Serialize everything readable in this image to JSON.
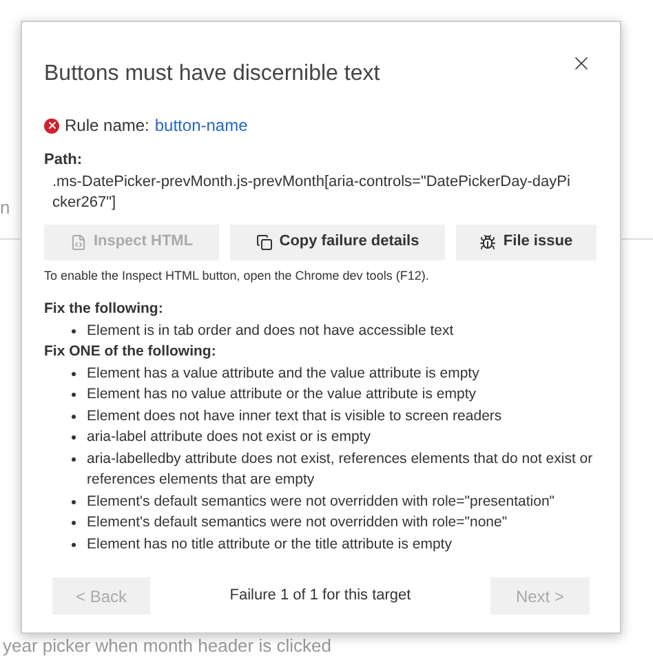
{
  "background": {
    "texts": [
      "n",
      "year picker when month header is clicked"
    ]
  },
  "dialog": {
    "title": "Buttons must have discernible text",
    "rule": {
      "label": "Rule name:",
      "value": "button-name"
    },
    "path": {
      "label": "Path:",
      "value": ".ms-DatePicker-prevMonth.js-prevMonth[aria-controls=\"DatePickerDay-dayPicker267\"]"
    },
    "actions": [
      {
        "label": "Inspect HTML",
        "disabled": true
      },
      {
        "label": "Copy failure details",
        "disabled": false
      },
      {
        "label": "File issue",
        "disabled": false
      }
    ],
    "hint": "To enable the Inspect HTML button, open the Chrome dev tools (F12).",
    "sections": [
      {
        "heading": "Fix the following:",
        "items": [
          "Element is in tab order and does not have accessible text"
        ]
      },
      {
        "heading": "Fix ONE of the following:",
        "items": [
          "Element has a value attribute and the value attribute is empty",
          "Element has no value attribute or the value attribute is empty",
          "Element does not have inner text that is visible to screen readers",
          "aria-label attribute does not exist or is empty",
          "aria-labelledby attribute does not exist, references elements that do not exist or references elements that are empty",
          "Element's default semantics were not overridden with role=\"presentation\"",
          "Element's default semantics were not overridden with role=\"none\"",
          "Element has no title attribute or the title attribute is empty"
        ]
      }
    ],
    "footer": {
      "back": {
        "label": "< Back",
        "disabled": true
      },
      "status": "Failure 1 of 1 for this target",
      "next": {
        "label": "Next >",
        "disabled": true
      }
    }
  }
}
